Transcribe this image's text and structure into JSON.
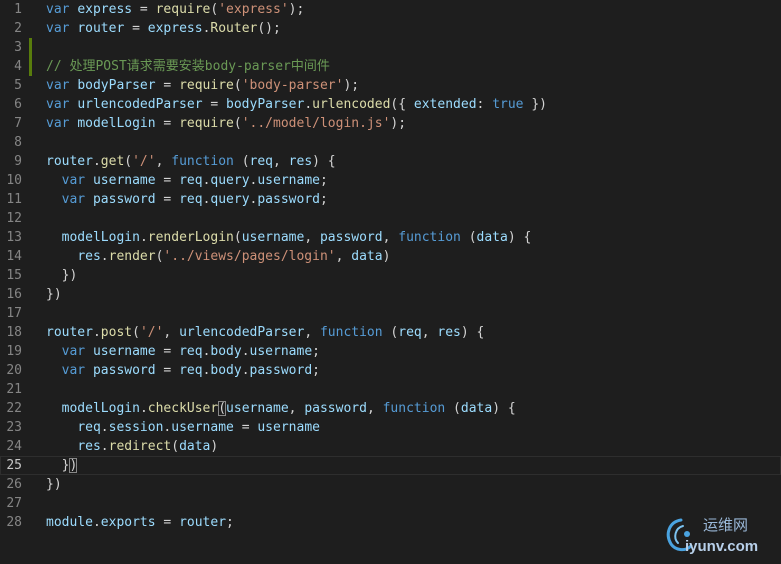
{
  "editor": {
    "theme_colors": {
      "background": "#1e1e1e",
      "line_number": "#858585",
      "keyword": "#569cd6",
      "identifier": "#9cdcfe",
      "function": "#dcdcaa",
      "string": "#ce9178",
      "comment": "#6a9955",
      "modified_gutter": "#587c0c"
    },
    "current_line": 25,
    "modified_lines": [
      3,
      4
    ],
    "lines": [
      {
        "n": "1",
        "tokens": [
          [
            "k",
            "var"
          ],
          [
            "p",
            " "
          ],
          [
            "i",
            "express"
          ],
          [
            "p",
            " = "
          ],
          [
            "f",
            "require"
          ],
          [
            "p",
            "("
          ],
          [
            "s",
            "'express'"
          ],
          [
            "p",
            ");"
          ]
        ]
      },
      {
        "n": "2",
        "tokens": [
          [
            "k",
            "var"
          ],
          [
            "p",
            " "
          ],
          [
            "i",
            "router"
          ],
          [
            "p",
            " = "
          ],
          [
            "i",
            "express"
          ],
          [
            "p",
            "."
          ],
          [
            "f",
            "Router"
          ],
          [
            "p",
            "();"
          ]
        ]
      },
      {
        "n": "3",
        "tokens": []
      },
      {
        "n": "4",
        "tokens": [
          [
            "c",
            "// 处理POST请求需要安装body-parser中间件"
          ]
        ]
      },
      {
        "n": "5",
        "tokens": [
          [
            "k",
            "var"
          ],
          [
            "p",
            " "
          ],
          [
            "i",
            "bodyParser"
          ],
          [
            "p",
            " = "
          ],
          [
            "f",
            "require"
          ],
          [
            "p",
            "("
          ],
          [
            "s",
            "'body-parser'"
          ],
          [
            "p",
            ");"
          ]
        ]
      },
      {
        "n": "6",
        "tokens": [
          [
            "k",
            "var"
          ],
          [
            "p",
            " "
          ],
          [
            "i",
            "urlencodedParser"
          ],
          [
            "p",
            " = "
          ],
          [
            "i",
            "bodyParser"
          ],
          [
            "p",
            "."
          ],
          [
            "f",
            "urlencoded"
          ],
          [
            "p",
            "({ "
          ],
          [
            "i",
            "extended"
          ],
          [
            "p",
            ": "
          ],
          [
            "k",
            "true"
          ],
          [
            "p",
            " })"
          ]
        ]
      },
      {
        "n": "7",
        "tokens": [
          [
            "k",
            "var"
          ],
          [
            "p",
            " "
          ],
          [
            "i",
            "modelLogin"
          ],
          [
            "p",
            " = "
          ],
          [
            "f",
            "require"
          ],
          [
            "p",
            "("
          ],
          [
            "s",
            "'../model/login.js'"
          ],
          [
            "p",
            ");"
          ]
        ]
      },
      {
        "n": "8",
        "tokens": []
      },
      {
        "n": "9",
        "tokens": [
          [
            "i",
            "router"
          ],
          [
            "p",
            "."
          ],
          [
            "f",
            "get"
          ],
          [
            "p",
            "("
          ],
          [
            "s",
            "'/'"
          ],
          [
            "p",
            ", "
          ],
          [
            "k",
            "function"
          ],
          [
            "p",
            " ("
          ],
          [
            "i",
            "req"
          ],
          [
            "p",
            ", "
          ],
          [
            "i",
            "res"
          ],
          [
            "p",
            ") {"
          ]
        ]
      },
      {
        "n": "10",
        "tokens": [
          [
            "p",
            "  "
          ],
          [
            "k",
            "var"
          ],
          [
            "p",
            " "
          ],
          [
            "i",
            "username"
          ],
          [
            "p",
            " = "
          ],
          [
            "i",
            "req"
          ],
          [
            "p",
            "."
          ],
          [
            "i",
            "query"
          ],
          [
            "p",
            "."
          ],
          [
            "i",
            "username"
          ],
          [
            "p",
            ";"
          ]
        ]
      },
      {
        "n": "11",
        "tokens": [
          [
            "p",
            "  "
          ],
          [
            "k",
            "var"
          ],
          [
            "p",
            " "
          ],
          [
            "i",
            "password"
          ],
          [
            "p",
            " = "
          ],
          [
            "i",
            "req"
          ],
          [
            "p",
            "."
          ],
          [
            "i",
            "query"
          ],
          [
            "p",
            "."
          ],
          [
            "i",
            "password"
          ],
          [
            "p",
            ";"
          ]
        ]
      },
      {
        "n": "12",
        "tokens": []
      },
      {
        "n": "13",
        "tokens": [
          [
            "p",
            "  "
          ],
          [
            "i",
            "modelLogin"
          ],
          [
            "p",
            "."
          ],
          [
            "f",
            "renderLogin"
          ],
          [
            "p",
            "("
          ],
          [
            "i",
            "username"
          ],
          [
            "p",
            ", "
          ],
          [
            "i",
            "password"
          ],
          [
            "p",
            ", "
          ],
          [
            "k",
            "function"
          ],
          [
            "p",
            " ("
          ],
          [
            "i",
            "data"
          ],
          [
            "p",
            ") {"
          ]
        ]
      },
      {
        "n": "14",
        "tokens": [
          [
            "p",
            "    "
          ],
          [
            "i",
            "res"
          ],
          [
            "p",
            "."
          ],
          [
            "f",
            "render"
          ],
          [
            "p",
            "("
          ],
          [
            "s",
            "'../views/pages/login'"
          ],
          [
            "p",
            ", "
          ],
          [
            "i",
            "data"
          ],
          [
            "p",
            ")"
          ]
        ]
      },
      {
        "n": "15",
        "tokens": [
          [
            "p",
            "  })"
          ]
        ]
      },
      {
        "n": "16",
        "tokens": [
          [
            "p",
            "})"
          ]
        ]
      },
      {
        "n": "17",
        "tokens": []
      },
      {
        "n": "18",
        "tokens": [
          [
            "i",
            "router"
          ],
          [
            "p",
            "."
          ],
          [
            "f",
            "post"
          ],
          [
            "p",
            "("
          ],
          [
            "s",
            "'/'"
          ],
          [
            "p",
            ", "
          ],
          [
            "i",
            "urlencodedParser"
          ],
          [
            "p",
            ", "
          ],
          [
            "k",
            "function"
          ],
          [
            "p",
            " ("
          ],
          [
            "i",
            "req"
          ],
          [
            "p",
            ", "
          ],
          [
            "i",
            "res"
          ],
          [
            "p",
            ") {"
          ]
        ]
      },
      {
        "n": "19",
        "tokens": [
          [
            "p",
            "  "
          ],
          [
            "k",
            "var"
          ],
          [
            "p",
            " "
          ],
          [
            "i",
            "username"
          ],
          [
            "p",
            " = "
          ],
          [
            "i",
            "req"
          ],
          [
            "p",
            "."
          ],
          [
            "i",
            "body"
          ],
          [
            "p",
            "."
          ],
          [
            "i",
            "username"
          ],
          [
            "p",
            ";"
          ]
        ]
      },
      {
        "n": "20",
        "tokens": [
          [
            "p",
            "  "
          ],
          [
            "k",
            "var"
          ],
          [
            "p",
            " "
          ],
          [
            "i",
            "password"
          ],
          [
            "p",
            " = "
          ],
          [
            "i",
            "req"
          ],
          [
            "p",
            "."
          ],
          [
            "i",
            "body"
          ],
          [
            "p",
            "."
          ],
          [
            "i",
            "password"
          ],
          [
            "p",
            ";"
          ]
        ]
      },
      {
        "n": "21",
        "tokens": []
      },
      {
        "n": "22",
        "tokens": [
          [
            "p",
            "  "
          ],
          [
            "i",
            "modelLogin"
          ],
          [
            "p",
            "."
          ],
          [
            "f",
            "checkUser"
          ],
          [
            "b",
            "("
          ],
          [
            "i",
            "username"
          ],
          [
            "p",
            ", "
          ],
          [
            "i",
            "password"
          ],
          [
            "p",
            ", "
          ],
          [
            "k",
            "function"
          ],
          [
            "p",
            " ("
          ],
          [
            "i",
            "data"
          ],
          [
            "p",
            ") {"
          ]
        ]
      },
      {
        "n": "23",
        "tokens": [
          [
            "p",
            "    "
          ],
          [
            "i",
            "req"
          ],
          [
            "p",
            "."
          ],
          [
            "i",
            "session"
          ],
          [
            "p",
            "."
          ],
          [
            "i",
            "username"
          ],
          [
            "p",
            " = "
          ],
          [
            "i",
            "username"
          ]
        ]
      },
      {
        "n": "24",
        "tokens": [
          [
            "p",
            "    "
          ],
          [
            "i",
            "res"
          ],
          [
            "p",
            "."
          ],
          [
            "f",
            "redirect"
          ],
          [
            "p",
            "("
          ],
          [
            "i",
            "data"
          ],
          [
            "p",
            ")"
          ]
        ]
      },
      {
        "n": "25",
        "tokens": [
          [
            "p",
            "  }"
          ],
          [
            "b",
            ")"
          ]
        ]
      },
      {
        "n": "26",
        "tokens": [
          [
            "p",
            "})"
          ]
        ]
      },
      {
        "n": "27",
        "tokens": []
      },
      {
        "n": "28",
        "tokens": [
          [
            "i",
            "module"
          ],
          [
            "p",
            "."
          ],
          [
            "i",
            "exports"
          ],
          [
            "p",
            " = "
          ],
          [
            "i",
            "router"
          ],
          [
            "p",
            ";"
          ]
        ]
      }
    ]
  },
  "watermark": {
    "brand": "运维网",
    "domain": "iyunv.com",
    "logo_icon": "swirl-logo-icon"
  }
}
